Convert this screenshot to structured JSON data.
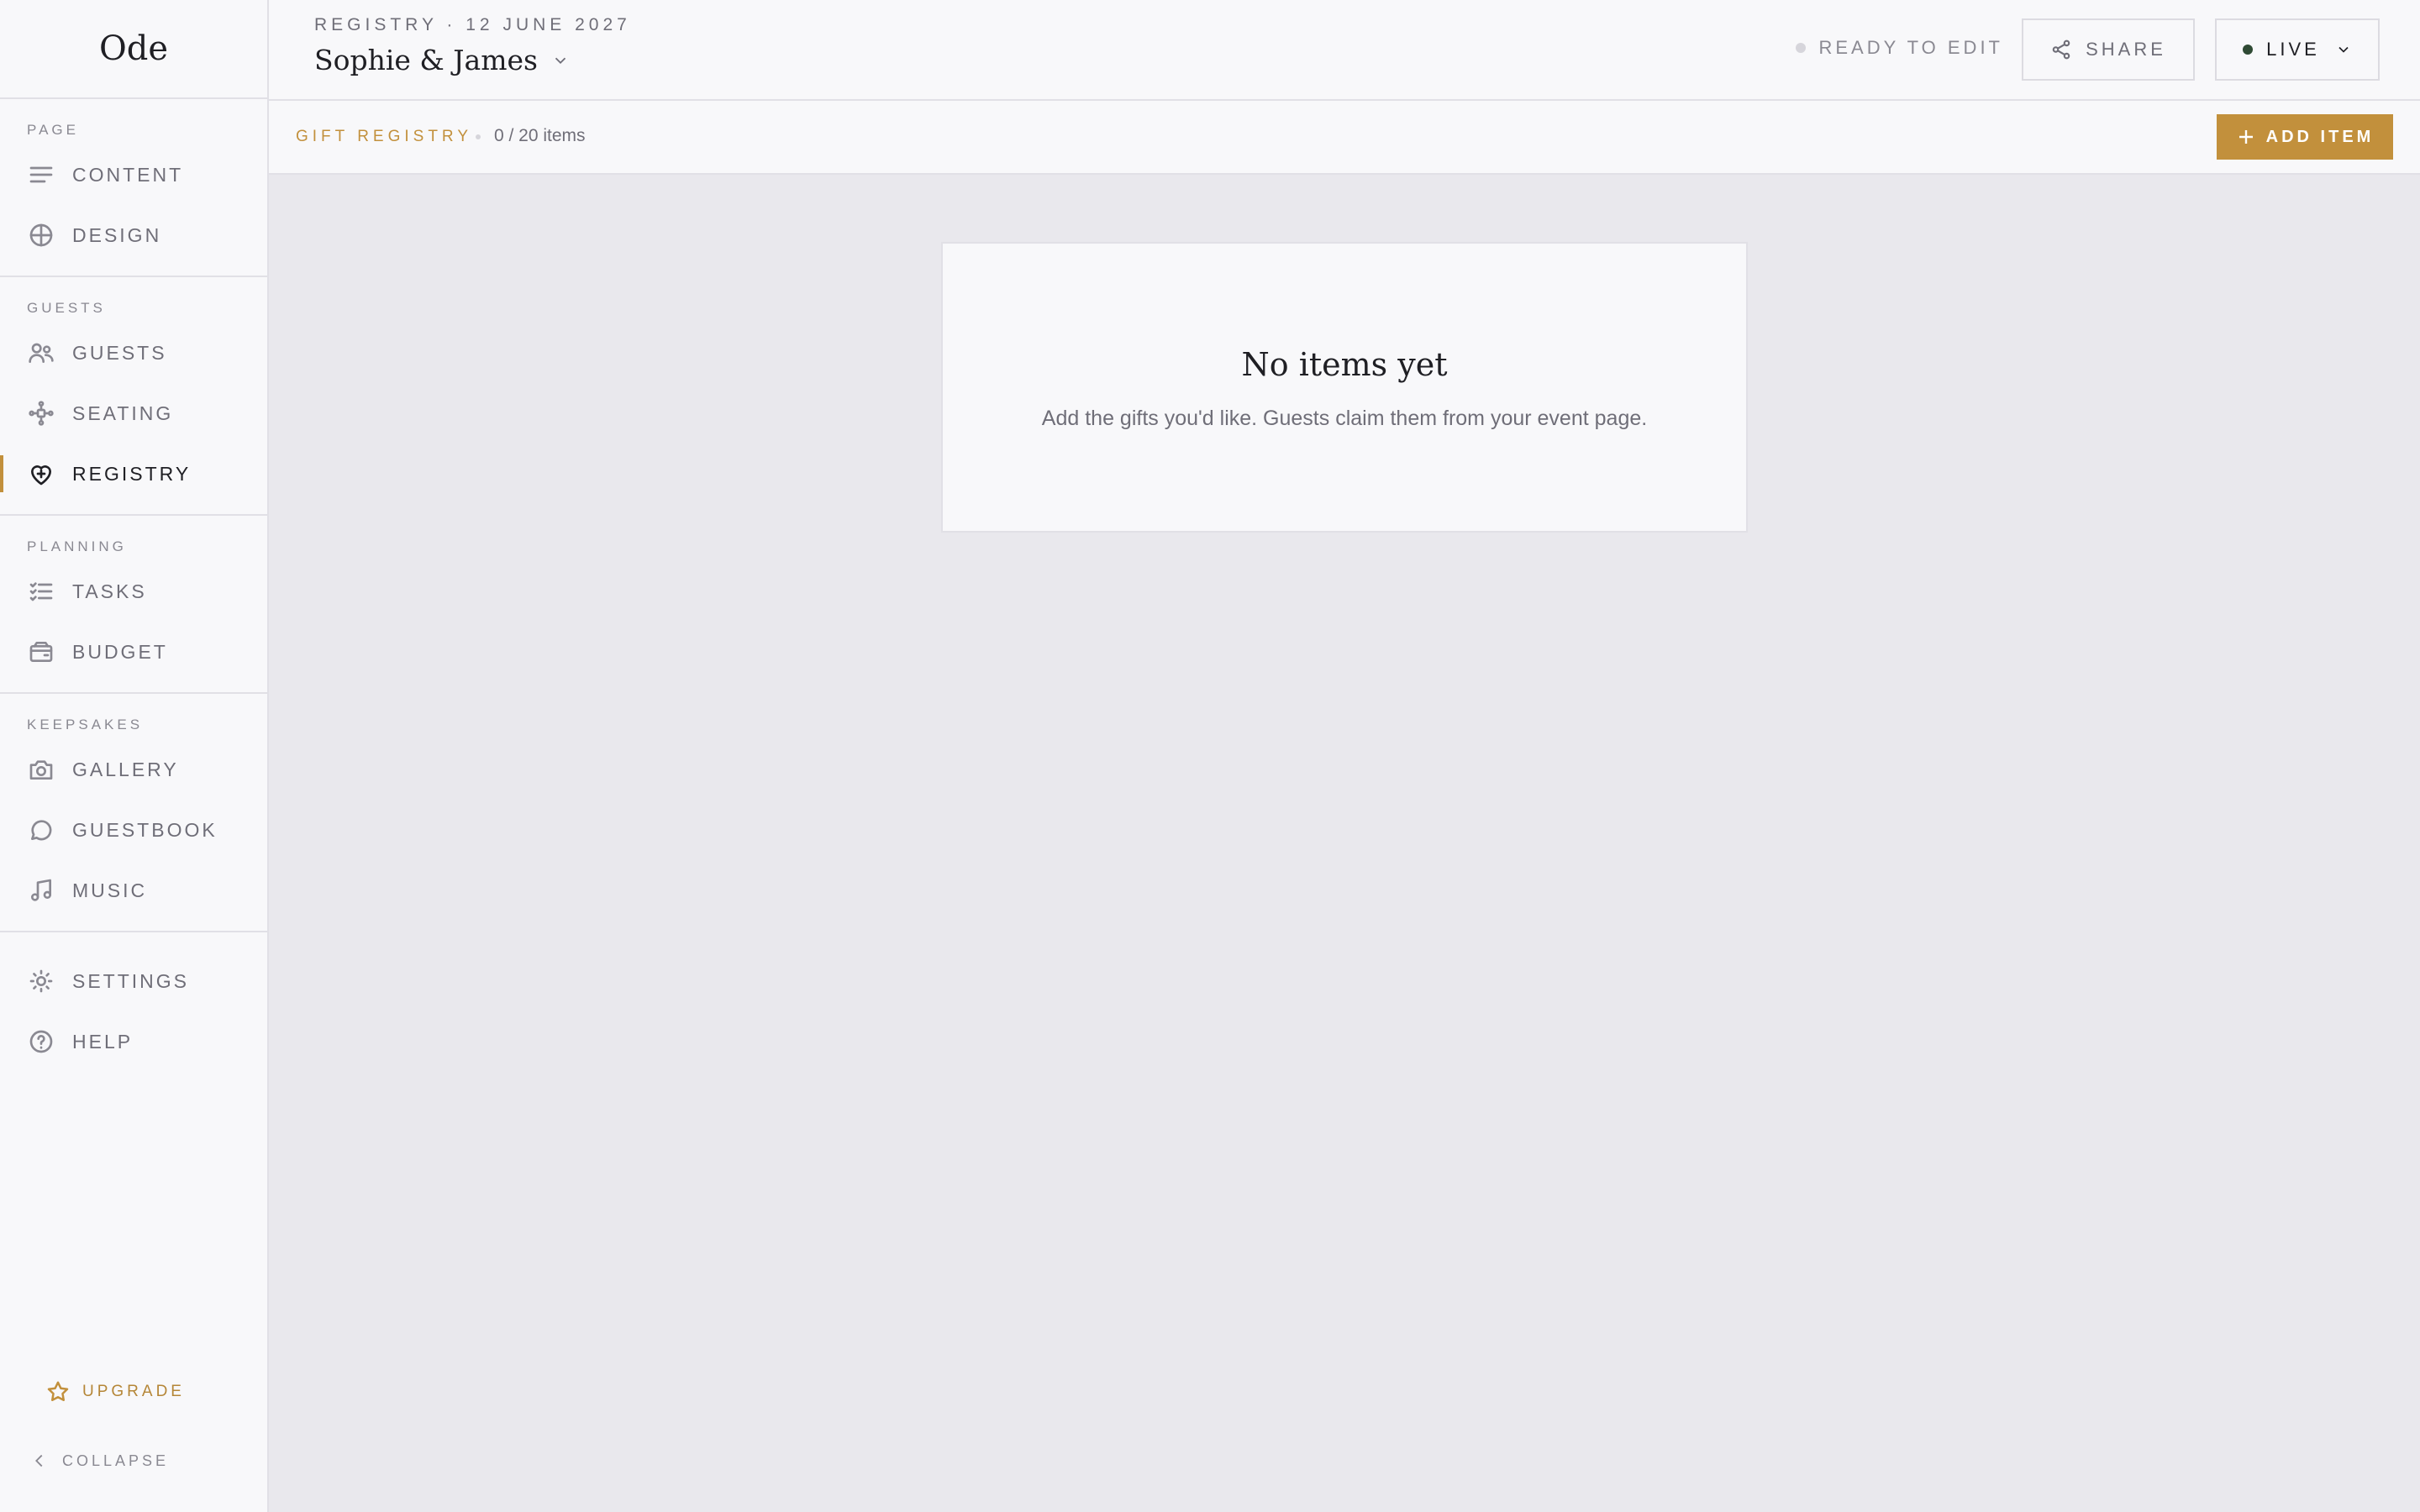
{
  "app": {
    "logo": "Ode"
  },
  "sidebar": {
    "sections": [
      {
        "heading": "PAGE",
        "items": [
          {
            "label": "CONTENT",
            "icon": "lines-icon"
          },
          {
            "label": "DESIGN",
            "icon": "globe-icon"
          }
        ]
      },
      {
        "heading": "GUESTS",
        "items": [
          {
            "label": "GUESTS",
            "icon": "people-icon"
          },
          {
            "label": "SEATING",
            "icon": "seating-icon"
          },
          {
            "label": "REGISTRY",
            "icon": "heart-gift-icon",
            "active": true
          }
        ]
      },
      {
        "heading": "PLANNING",
        "items": [
          {
            "label": "TASKS",
            "icon": "checklist-icon"
          },
          {
            "label": "BUDGET",
            "icon": "wallet-icon"
          }
        ]
      },
      {
        "heading": "KEEPSAKES",
        "items": [
          {
            "label": "GALLERY",
            "icon": "camera-icon"
          },
          {
            "label": "GUESTBOOK",
            "icon": "chat-bubble-icon"
          },
          {
            "label": "MUSIC",
            "icon": "music-note-icon"
          }
        ]
      },
      {
        "heading": "",
        "items": [
          {
            "label": "SETTINGS",
            "icon": "sun-gear-icon"
          },
          {
            "label": "HELP",
            "icon": "help-circle-icon"
          }
        ]
      }
    ],
    "upgrade_label": "UPGRADE",
    "collapse_label": "COLLAPSE"
  },
  "topbar": {
    "breadcrumb": "REGISTRY · 12 JUNE 2027",
    "event_name": "Sophie & James",
    "status": "READY TO EDIT",
    "share_label": "SHARE",
    "live_label": "LIVE"
  },
  "subbar": {
    "title": "GIFT REGISTRY",
    "count": "0 / 20 items",
    "add_label": "ADD ITEM"
  },
  "empty_state": {
    "title": "No items yet",
    "message": "Add the gifts you'd like. Guests claim them from your event page."
  },
  "colors": {
    "accent": "#c2903c",
    "live_dot": "#2f4a34",
    "canvas": "#e9e8ed",
    "panel": "#f8f8fa"
  }
}
